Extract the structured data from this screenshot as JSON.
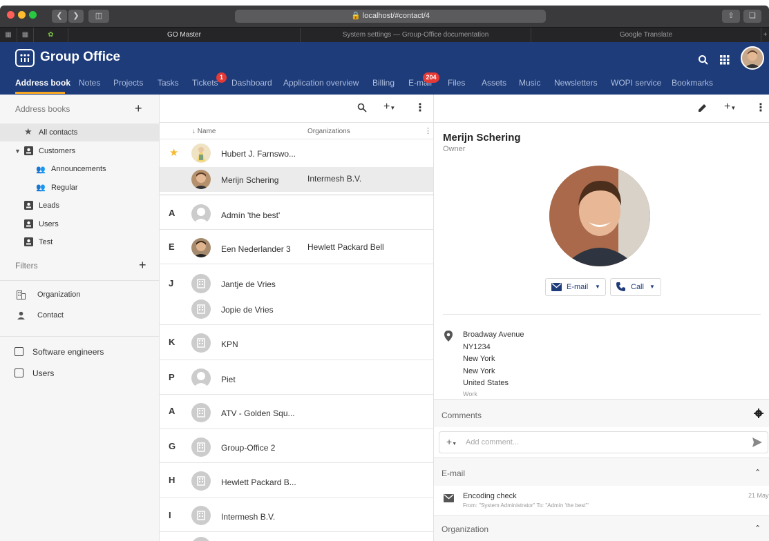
{
  "browser": {
    "url": "localhost/#contact/4",
    "tabs": [
      "GO Master",
      "System settings — Group-Office documentation",
      "Google Translate"
    ]
  },
  "app": {
    "name": "Group Office",
    "modules": [
      {
        "label": "Address book"
      },
      {
        "label": "Notes"
      },
      {
        "label": "Projects"
      },
      {
        "label": "Tasks"
      },
      {
        "label": "Tickets",
        "badge": "1"
      },
      {
        "label": "Dashboard"
      },
      {
        "label": "Application overview"
      },
      {
        "label": "Billing"
      },
      {
        "label": "E-mail",
        "badge": "204"
      },
      {
        "label": "Files"
      },
      {
        "label": "Assets"
      },
      {
        "label": "Music"
      },
      {
        "label": "Newsletters"
      },
      {
        "label": "WOPI service"
      },
      {
        "label": "Bookmarks"
      }
    ]
  },
  "sidebar": {
    "address_books_title": "Address books",
    "items": [
      {
        "label": "All contacts"
      },
      {
        "label": "Customers"
      },
      {
        "label": "Announcements"
      },
      {
        "label": "Regular"
      },
      {
        "label": "Leads"
      },
      {
        "label": "Users"
      },
      {
        "label": "Test"
      }
    ],
    "filters_title": "Filters",
    "filters": [
      {
        "label": "Organization"
      },
      {
        "label": "Contact"
      }
    ],
    "checkboxes": [
      {
        "label": "Software engineers"
      },
      {
        "label": "Users"
      }
    ]
  },
  "list": {
    "col_name": "Name",
    "col_org": "Organizations",
    "rows": [
      {
        "letter": "",
        "name": "Hubert J. Farnswo...",
        "org": ""
      },
      {
        "letter": "",
        "name": "Merijn Schering",
        "org": "Intermesh B.V."
      },
      {
        "letter": "A",
        "name": "Admín 'the best'",
        "org": ""
      },
      {
        "letter": "E",
        "name": "Een Nederlander 3",
        "org": "Hewlett Packard Bell"
      },
      {
        "letter": "J",
        "name": "Jantje de Vries",
        "org": ""
      },
      {
        "letter": "",
        "name": "Jopie de Vries",
        "org": ""
      },
      {
        "letter": "K",
        "name": "KPN",
        "org": ""
      },
      {
        "letter": "P",
        "name": "Piet",
        "org": ""
      },
      {
        "letter": "A",
        "name": "ATV - Golden Squ...",
        "org": ""
      },
      {
        "letter": "G",
        "name": "Group-Office 2",
        "org": ""
      },
      {
        "letter": "H",
        "name": "Hewlett Packard B...",
        "org": ""
      },
      {
        "letter": "I",
        "name": "Intermesh B.V.",
        "org": ""
      }
    ]
  },
  "detail": {
    "name": "Merijn Schering",
    "role": "Owner",
    "email_btn": "E-mail",
    "call_btn": "Call",
    "address": [
      "Broadway Avenue",
      "NY1234",
      "New York",
      "New York",
      "United States"
    ],
    "address_type": "Work",
    "comments_title": "Comments",
    "comment_placeholder": "Add comment...",
    "email_title": "E-mail",
    "email_subject": "Encoding check",
    "email_from": "From: \"System Administrator\" To: \"Admín 'the best'\"",
    "email_date": "21 May",
    "org_title": "Organization"
  },
  "colors": {
    "header": "#1e3c7a",
    "accent": "#f5a623",
    "badge": "#e53935"
  }
}
